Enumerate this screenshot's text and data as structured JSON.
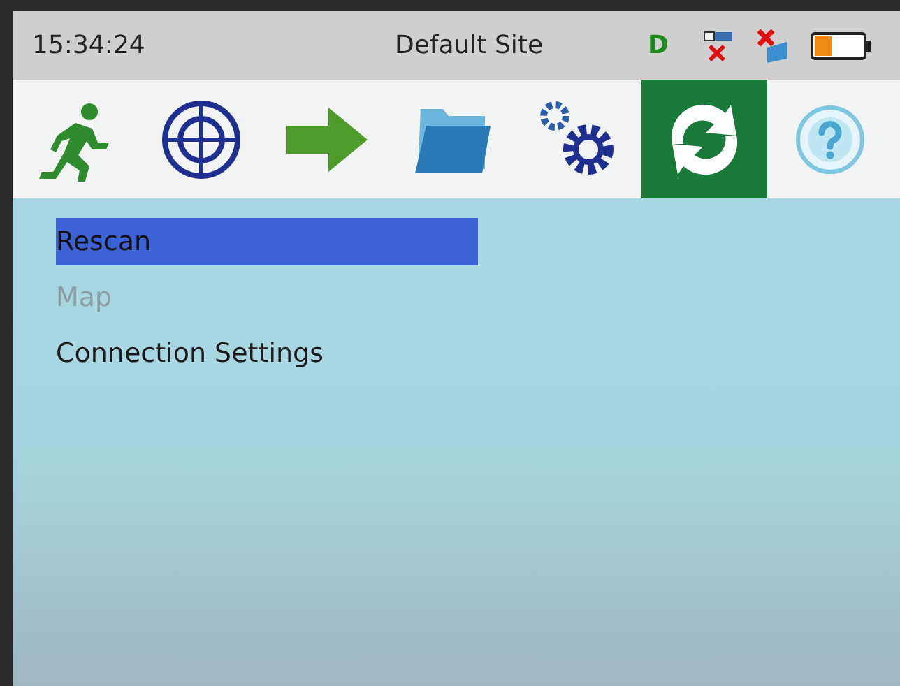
{
  "status_bar": {
    "time": "15:34:24",
    "site": "Default Site",
    "indicator": "D"
  },
  "toolbar": [
    {
      "kind": "run",
      "selected": false
    },
    {
      "kind": "target",
      "selected": false
    },
    {
      "kind": "arrow",
      "selected": false
    },
    {
      "kind": "folder",
      "selected": false
    },
    {
      "kind": "gears",
      "selected": false
    },
    {
      "kind": "refresh",
      "selected": true
    },
    {
      "kind": "help",
      "selected": false
    }
  ],
  "menu": [
    {
      "label": "Rescan",
      "selected": true,
      "disabled": false
    },
    {
      "label": "Map",
      "selected": false,
      "disabled": true
    },
    {
      "label": "Connection Settings",
      "selected": false,
      "disabled": false
    }
  ]
}
